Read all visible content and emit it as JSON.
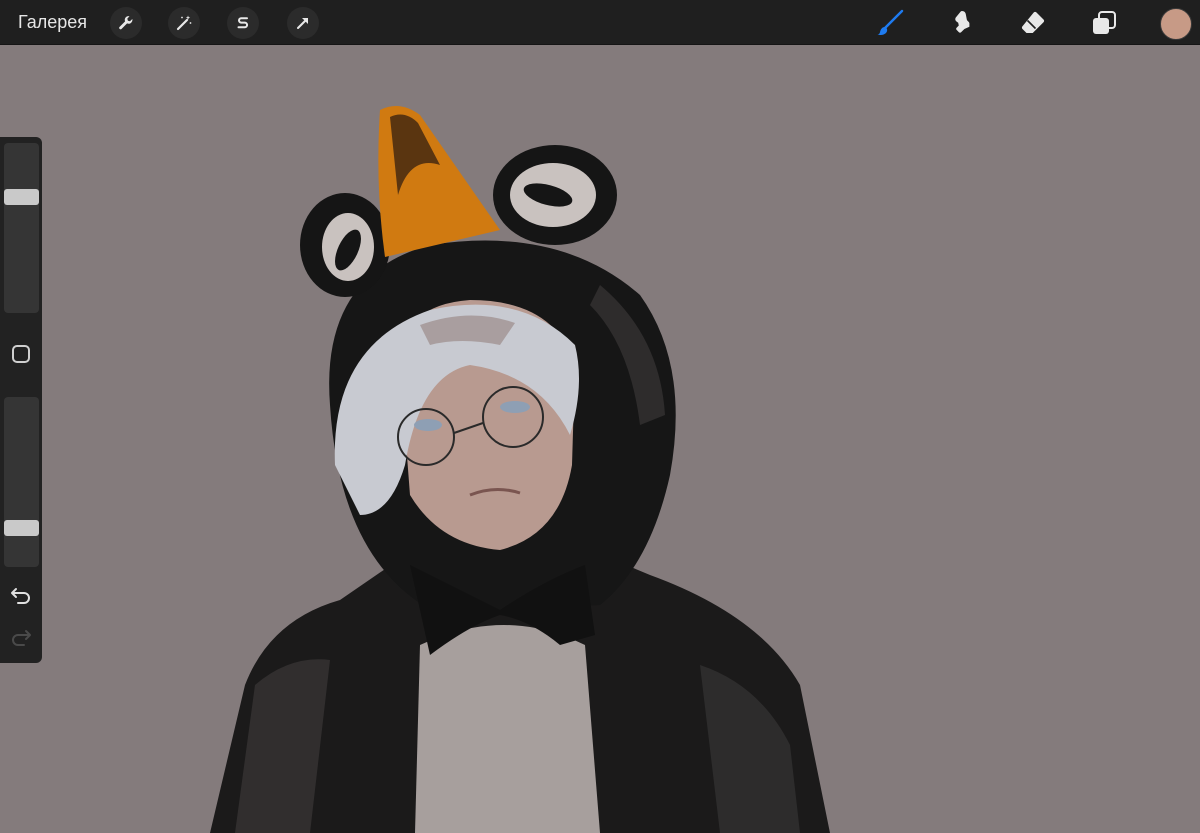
{
  "app": {
    "gallery_label": "Галерея"
  },
  "toolbar_left": {
    "icons": [
      "wrench-icon",
      "magic-wand-icon",
      "selection-s-icon",
      "transform-arrow-icon"
    ]
  },
  "toolbar_right": {
    "active_tool": "brush",
    "icons": [
      "brush-icon",
      "smudge-icon",
      "eraser-icon",
      "layers-icon"
    ],
    "current_color": "#c79a86",
    "active_color": "#1e7bf0"
  },
  "sidebar": {
    "brush_size_level": 0.3,
    "opacity_level": 0.8,
    "icons": [
      "modifier-square-icon",
      "undo-icon",
      "redo-icon"
    ]
  },
  "canvas": {
    "background": "#847b7c",
    "subject": "penguin-hood-portrait"
  }
}
